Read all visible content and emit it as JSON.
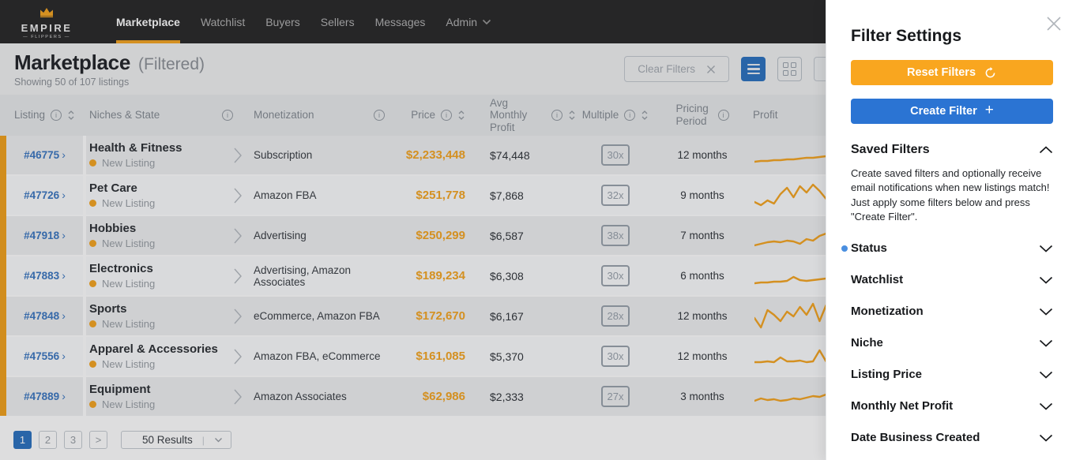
{
  "brand": {
    "name": "EMPIRE",
    "tagline": "— FLIPPERS —"
  },
  "nav": {
    "items": [
      {
        "label": "Marketplace",
        "active": true
      },
      {
        "label": "Watchlist"
      },
      {
        "label": "Buyers"
      },
      {
        "label": "Sellers"
      },
      {
        "label": "Messages"
      },
      {
        "label": "Admin",
        "has_dropdown": true
      }
    ]
  },
  "header": {
    "title": "Marketplace",
    "subtitle": "(Filtered)",
    "showing": "Showing 50 of 107 listings",
    "clear_filters_label": "Clear Filters"
  },
  "table": {
    "columns": [
      {
        "label": "Listing",
        "info": true,
        "sort": true
      },
      {
        "label": "Niches & State",
        "info": true
      },
      {
        "label": "Monetization",
        "info": true
      },
      {
        "label": "Price",
        "info": true,
        "sort": true
      },
      {
        "label": "Avg Monthly Profit",
        "info": true,
        "sort": true
      },
      {
        "label": "Multiple",
        "info": true,
        "sort": true
      },
      {
        "label": "Pricing Period",
        "info": true
      },
      {
        "label": "Profit"
      }
    ],
    "rows": [
      {
        "id": "#46775",
        "niche": "Health & Fitness",
        "status": "New Listing",
        "monetization": "Subscription",
        "price": "$2,233,448",
        "avg_profit": "$74,448",
        "multiple": "30x",
        "period": "12 months",
        "sparkline": [
          28,
          27,
          27,
          26,
          26,
          25,
          25,
          24,
          23,
          23,
          22,
          21,
          21,
          19,
          14,
          20,
          17,
          18
        ]
      },
      {
        "id": "#47726",
        "niche": "Pet Care",
        "status": "New Listing",
        "monetization": "Amazon FBA",
        "price": "$251,778",
        "avg_profit": "$7,868",
        "multiple": "32x",
        "period": "9 months",
        "sparkline": [
          28,
          32,
          26,
          30,
          18,
          10,
          22,
          8,
          16,
          6,
          14,
          24,
          30,
          14,
          8,
          20,
          30,
          24
        ]
      },
      {
        "id": "#47918",
        "niche": "Hobbies",
        "status": "New Listing",
        "monetization": "Advertising",
        "price": "$250,299",
        "avg_profit": "$6,587",
        "multiple": "38x",
        "period": "7 months",
        "sparkline": [
          32,
          30,
          28,
          27,
          28,
          26,
          27,
          30,
          24,
          26,
          20,
          17,
          20,
          15,
          18,
          13,
          16,
          15
        ]
      },
      {
        "id": "#47883",
        "niche": "Electronics",
        "status": "New Listing",
        "monetization": "Advertising, Amazon Associates",
        "price": "$189,234",
        "avg_profit": "$6,308",
        "multiple": "30x",
        "period": "6 months",
        "sparkline": [
          29,
          28,
          28,
          27,
          27,
          26,
          21,
          25,
          26,
          25,
          24,
          23,
          22,
          21,
          19,
          17,
          15,
          14
        ]
      },
      {
        "id": "#47848",
        "niche": "Sports",
        "status": "New Listing",
        "monetization": "eCommerce, Amazon FBA",
        "price": "$172,670",
        "avg_profit": "$6,167",
        "multiple": "28x",
        "period": "12 months",
        "sparkline": [
          22,
          34,
          12,
          18,
          26,
          14,
          20,
          8,
          18,
          4,
          26,
          6,
          30,
          12,
          22,
          16,
          26,
          22
        ]
      },
      {
        "id": "#47556",
        "niche": "Apparel & Accessories",
        "status": "New Listing",
        "monetization": "Amazon FBA, eCommerce",
        "price": "$161,085",
        "avg_profit": "$5,370",
        "multiple": "30x",
        "period": "12 months",
        "sparkline": [
          27,
          27,
          26,
          27,
          21,
          26,
          26,
          25,
          27,
          26,
          12,
          26,
          27,
          25,
          26,
          25,
          27,
          26
        ]
      },
      {
        "id": "#47889",
        "niche": "Equipment",
        "status": "New Listing",
        "monetization": "Amazon Associates",
        "price": "$62,986",
        "avg_profit": "$2,333",
        "multiple": "27x",
        "period": "3 months",
        "sparkline": [
          25,
          22,
          24,
          23,
          25,
          24,
          22,
          23,
          21,
          19,
          20,
          17,
          16,
          17,
          14,
          15,
          13,
          14
        ]
      }
    ]
  },
  "pagination": {
    "pages": [
      "1",
      "2",
      "3",
      ">"
    ],
    "active_page": "1",
    "results_label": "50 Results"
  },
  "panel": {
    "title": "Filter Settings",
    "reset_label": "Reset Filters",
    "create_label": "Create Filter",
    "saved_filters": {
      "heading": "Saved Filters",
      "description": "Create saved filters and optionally receive email notifications when new listings match! Just apply some filters below and press \"Create Filter\"."
    },
    "filters": [
      {
        "label": "Status",
        "active": true
      },
      {
        "label": "Watchlist"
      },
      {
        "label": "Monetization"
      },
      {
        "label": "Niche"
      },
      {
        "label": "Listing Price"
      },
      {
        "label": "Monthly Net Profit"
      },
      {
        "label": "Date Business Created"
      }
    ]
  },
  "colors": {
    "accent_orange": "#f5a623",
    "accent_blue": "#2b74d3",
    "nav_bg": "#2b2b2b",
    "listing_id_blue": "#3d79c2"
  }
}
